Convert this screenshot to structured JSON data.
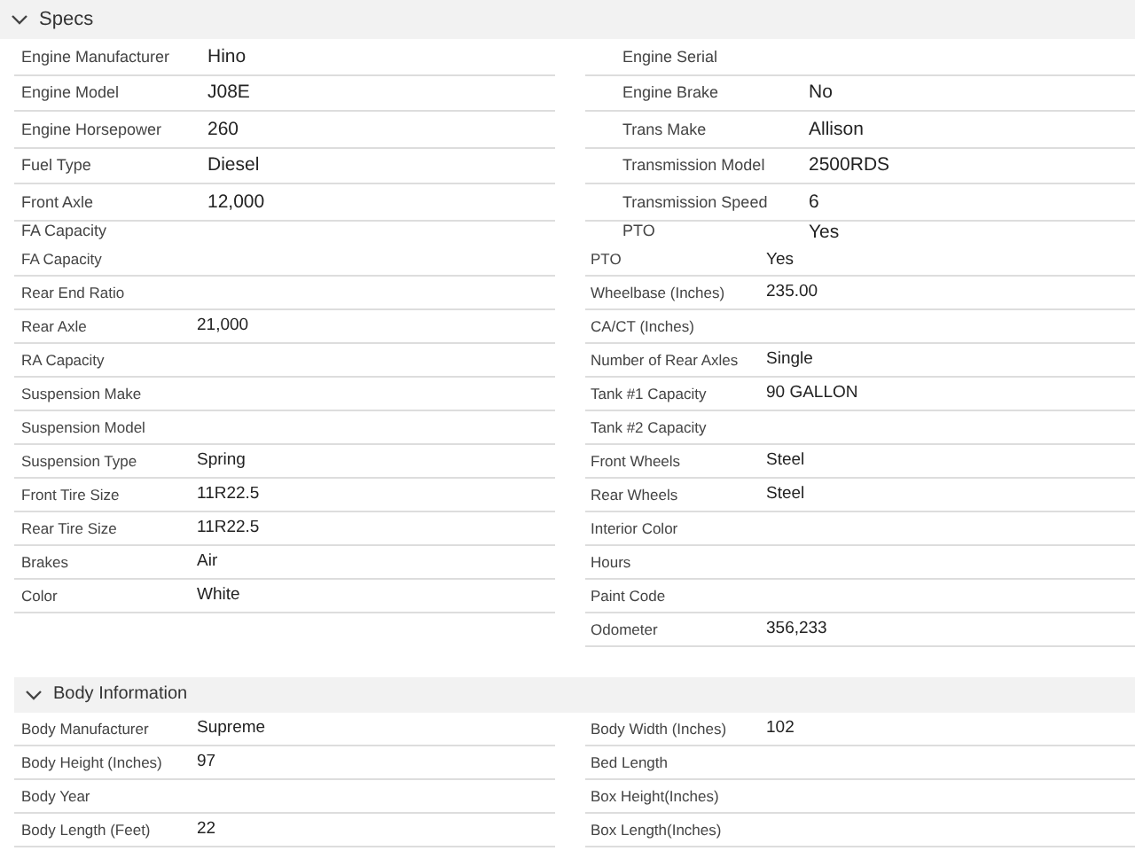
{
  "specs": {
    "title": "Specs",
    "expanded": true,
    "upper_view": {
      "left": [
        {
          "label": "Engine Manufacturer",
          "value": "Hino"
        },
        {
          "label": "Engine Model",
          "value": "J08E"
        },
        {
          "label": "Engine Horsepower",
          "value": "260"
        },
        {
          "label": "Fuel Type",
          "value": "Diesel"
        },
        {
          "label": "Front Axle",
          "value": "12,000"
        },
        {
          "label": "FA Capacity"
        }
      ],
      "right": [
        {
          "label": "Engine Serial"
        },
        {
          "label": "Engine Brake",
          "value": "No"
        },
        {
          "label": "Trans Make",
          "value": "Allison"
        },
        {
          "label": "Transmission Model",
          "value": "2500RDS"
        },
        {
          "label": "Transmission Speed",
          "value": "6"
        },
        {
          "label": "PTO",
          "value": "Yes"
        }
      ]
    },
    "lower_view": {
      "left": [
        {
          "label": "FA Capacity"
        },
        {
          "label": "Rear End Ratio"
        },
        {
          "label": "Rear Axle",
          "value": "21,000"
        },
        {
          "label": "RA Capacity"
        },
        {
          "label": "Suspension Make"
        },
        {
          "label": "Suspension Model"
        },
        {
          "label": "Suspension Type",
          "value": "Spring"
        },
        {
          "label": "Front Tire Size",
          "value": "11R22.5"
        },
        {
          "label": "Rear Tire Size",
          "value": "11R22.5"
        },
        {
          "label": "Brakes",
          "value": "Air"
        },
        {
          "label": "Color",
          "value": "White"
        }
      ],
      "right": [
        {
          "label": "PTO",
          "value": "Yes"
        },
        {
          "label": "Wheelbase (Inches)",
          "value": "235.00"
        },
        {
          "label": "CA/CT (Inches)"
        },
        {
          "label": "Number of Rear Axles",
          "value": "Single"
        },
        {
          "label": "Tank #1 Capacity",
          "value": "90 GALLON"
        },
        {
          "label": "Tank #2 Capacity"
        },
        {
          "label": "Front Wheels",
          "value": "Steel"
        },
        {
          "label": "Rear Wheels",
          "value": "Steel"
        },
        {
          "label": "Interior Color"
        },
        {
          "label": "Hours"
        },
        {
          "label": "Paint Code"
        },
        {
          "label": "Odometer",
          "value": "356,233"
        }
      ]
    }
  },
  "body_information": {
    "title": "Body Information",
    "expanded": true,
    "view": {
      "left": [
        {
          "label": "Body Manufacturer",
          "value": "Supreme"
        },
        {
          "label": "Body Height (Inches)",
          "value": "97"
        },
        {
          "label": "Body Year"
        },
        {
          "label": "Body Length (Feet)",
          "value": "22"
        }
      ],
      "right": [
        {
          "label": "Body Width (Inches)",
          "value": "102"
        },
        {
          "label": "Bed Length"
        },
        {
          "label": "Box Height(Inches)"
        },
        {
          "label": "Box Length(Inches)"
        }
      ]
    }
  }
}
